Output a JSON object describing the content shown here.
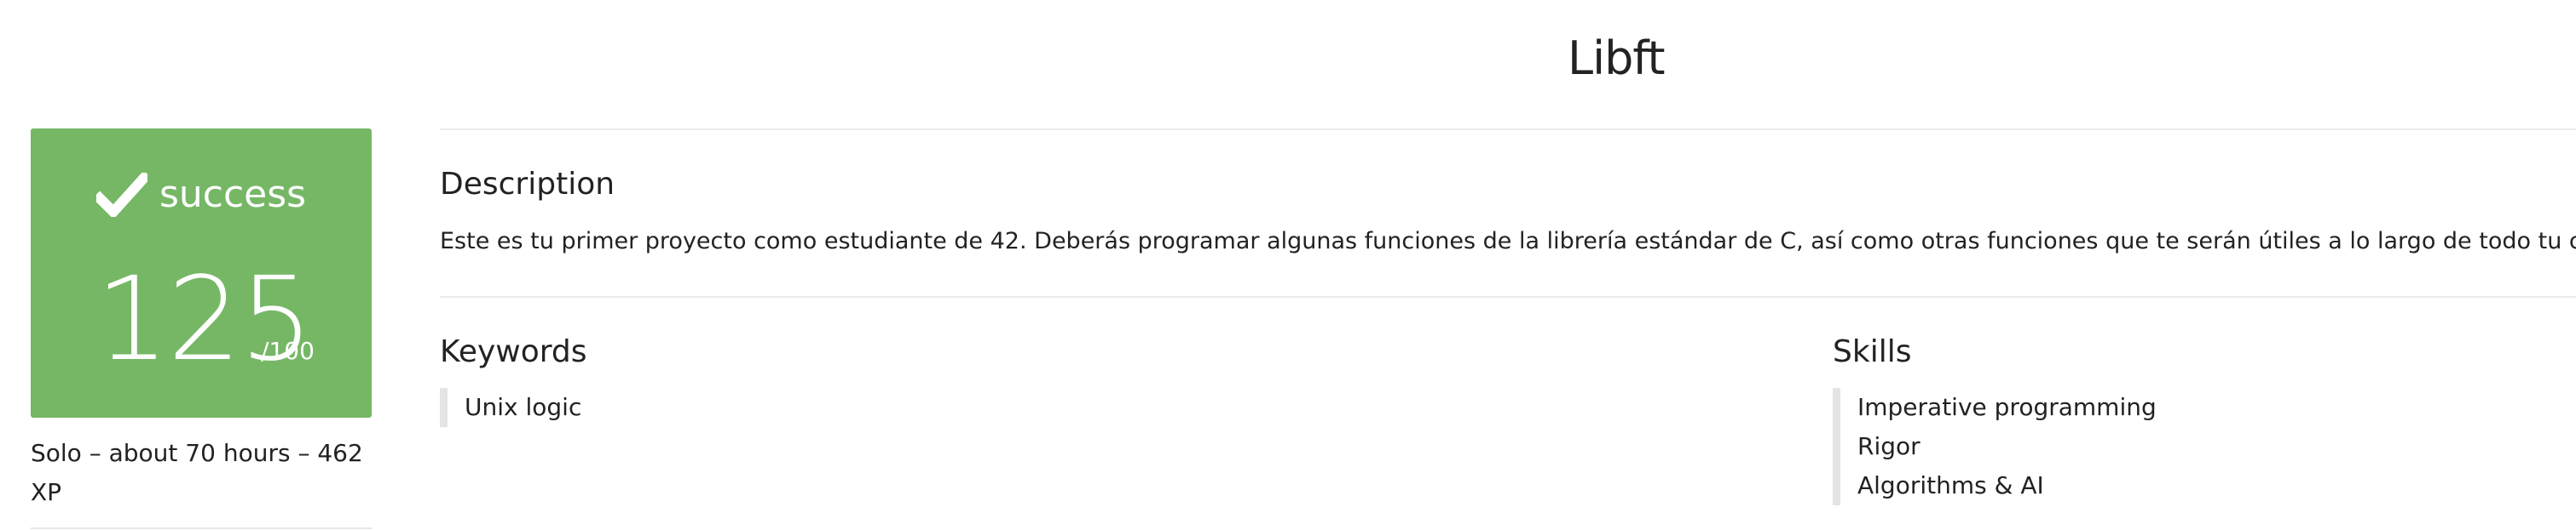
{
  "project": {
    "title": "Libft"
  },
  "result": {
    "status": "success",
    "score": "125",
    "max_score": "/100",
    "icon": "check-icon",
    "card_color": "#76b766"
  },
  "meta": {
    "summary": "Solo – about 70 hours – 462 XP"
  },
  "description": {
    "heading": "Description",
    "text": "Este es tu primer proyecto como estudiante de 42. Deberás programar algunas funciones de la librería estándar de C, así como otras funciones que te serán útiles a lo largo de todo tu cursus."
  },
  "keywords": {
    "heading": "Keywords",
    "items": [
      "Unix logic"
    ]
  },
  "skills": {
    "heading": "Skills",
    "items": [
      "Imperative programming",
      "Rigor",
      "Algorithms & AI"
    ]
  }
}
